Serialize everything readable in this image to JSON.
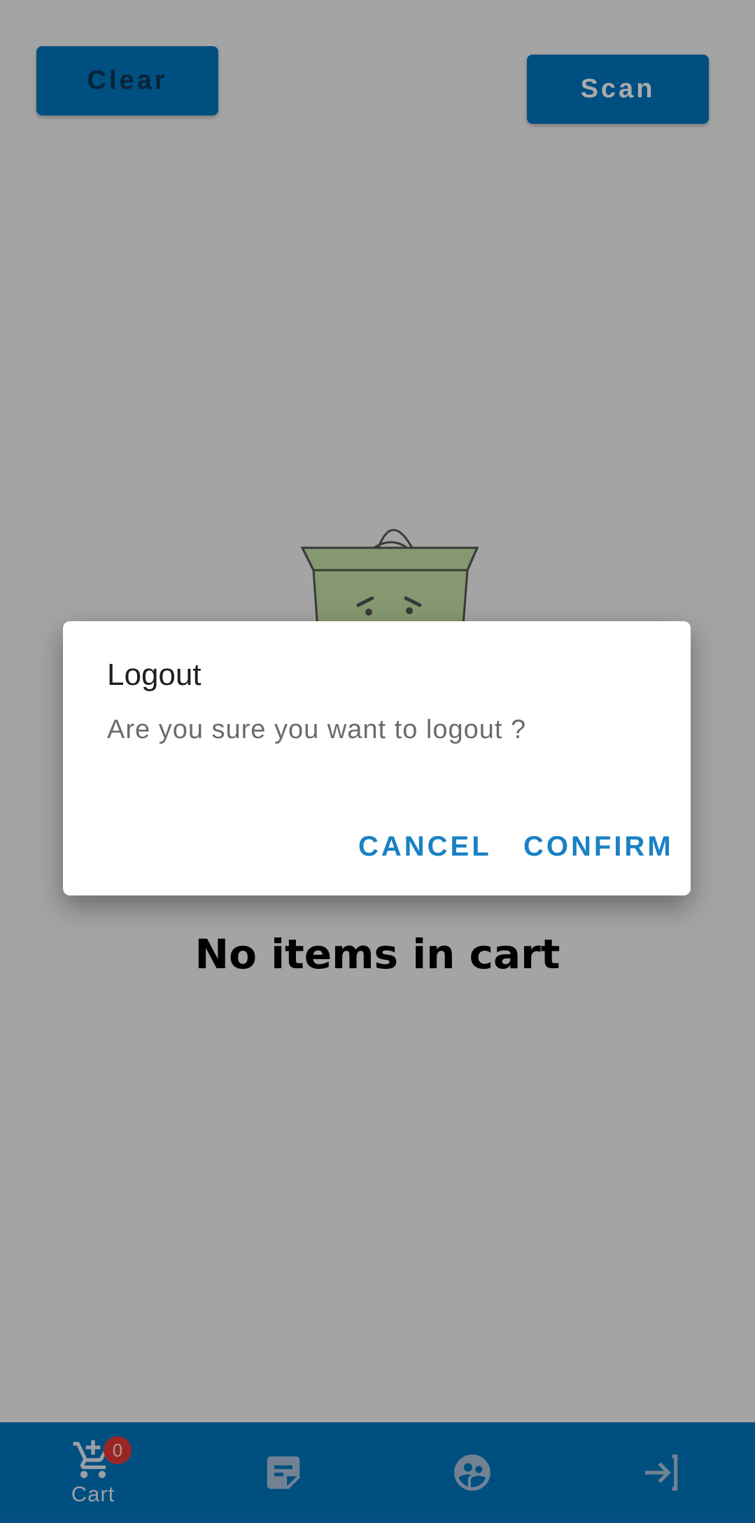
{
  "top_buttons": {
    "clear_label": "Clear",
    "scan_label": "Scan"
  },
  "empty_state": {
    "message": "No items in cart",
    "illustration": "sad-shopping-bag"
  },
  "bottom_nav": {
    "items": [
      {
        "label": "Cart",
        "icon": "cart-add-icon",
        "badge": "0"
      },
      {
        "label": "",
        "icon": "notes-icon"
      },
      {
        "label": "",
        "icon": "profile-icon"
      },
      {
        "label": "",
        "icon": "logout-icon"
      }
    ]
  },
  "dialog": {
    "title": "Logout",
    "message": "Are you sure you want to logout ?",
    "cancel_label": "CANCEL",
    "confirm_label": "CONFIRM"
  },
  "colors": {
    "primary": "#0177c1",
    "accent_text": "#1a81c4",
    "badge": "#e53935",
    "scrim": "rgba(0,0,0,0.33)"
  }
}
